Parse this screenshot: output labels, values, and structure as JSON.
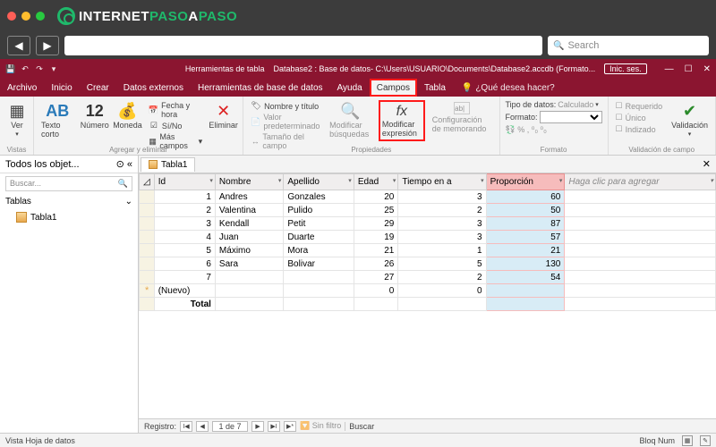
{
  "browser": {
    "search_placeholder": "Search"
  },
  "logo": {
    "pre": "INTERNET",
    "mid": "PASO",
    "post": "A",
    "end": "PASO"
  },
  "app": {
    "context_tab": "Herramientas de tabla",
    "title": "Database2 : Base de datos- C:\\Users\\USUARIO\\Documents\\Database2.accdb (Formato...",
    "signin": "Inic. ses."
  },
  "menu": {
    "items": [
      "Archivo",
      "Inicio",
      "Crear",
      "Datos externos",
      "Herramientas de base de datos",
      "Ayuda",
      "Campos",
      "Tabla"
    ],
    "active": "Campos",
    "tell_me": "¿Qué desea hacer?"
  },
  "ribbon": {
    "g_views": {
      "label": "Vistas",
      "ver": "Ver"
    },
    "g_add": {
      "label": "Agregar y eliminar",
      "texto": "Texto corto",
      "numero": "Número",
      "moneda": "Moneda",
      "fecha": "Fecha y hora",
      "sino": "Sí/No",
      "mas": "Más campos",
      "eliminar": "Eliminar",
      "ab": "AB",
      "doce": "12"
    },
    "g_props": {
      "label": "Propiedades",
      "nombre": "Nombre y título",
      "valor": "Valor predeterminado",
      "tam": "Tamaño del campo",
      "modbus": "Modificar búsquedas",
      "modexp": "Modificar expresión",
      "confmem": "Configuración de memorando"
    },
    "g_fmt": {
      "label": "Formato",
      "tipo": "Tipo de datos:",
      "tipo_v": "Calculado",
      "fmt": "Formato:"
    },
    "g_val": {
      "label": "Validación de campo",
      "req": "Requerido",
      "uni": "Único",
      "idx": "Indizado",
      "val": "Validación"
    }
  },
  "nav": {
    "header": "Todos los objet...",
    "search": "Buscar...",
    "cat": "Tablas",
    "obj": "Tabla1"
  },
  "datasheet": {
    "tab": "Tabla1",
    "columns": [
      "Id",
      "Nombre",
      "Apellido",
      "Edad",
      "Tiempo en a",
      "Proporción",
      "Haga clic para agregar"
    ],
    "rows": [
      {
        "id": "1",
        "nombre": "Andres",
        "apellido": "Gonzales",
        "edad": "20",
        "tiempo": "3",
        "prop": "60"
      },
      {
        "id": "2",
        "nombre": "Valentina",
        "apellido": "Pulido",
        "edad": "25",
        "tiempo": "2",
        "prop": "50"
      },
      {
        "id": "3",
        "nombre": "Kendall",
        "apellido": "Petit",
        "edad": "29",
        "tiempo": "3",
        "prop": "87"
      },
      {
        "id": "4",
        "nombre": "Juan",
        "apellido": "Duarte",
        "edad": "19",
        "tiempo": "3",
        "prop": "57"
      },
      {
        "id": "5",
        "nombre": "Máximo",
        "apellido": "Mora",
        "edad": "21",
        "tiempo": "1",
        "prop": "21"
      },
      {
        "id": "6",
        "nombre": "Sara",
        "apellido": "Bolivar",
        "edad": "26",
        "tiempo": "5",
        "prop": "130"
      },
      {
        "id": "7",
        "nombre": "",
        "apellido": "",
        "edad": "27",
        "tiempo": "2",
        "prop": "54"
      }
    ],
    "new_row": "(Nuevo)",
    "total": "Total"
  },
  "recnav": {
    "label": "Registro:",
    "pos": "1 de 7",
    "nofilter": "Sin filtro",
    "search": "Buscar"
  },
  "status": {
    "left": "Vista Hoja de datos",
    "numlock": "Bloq Num"
  }
}
